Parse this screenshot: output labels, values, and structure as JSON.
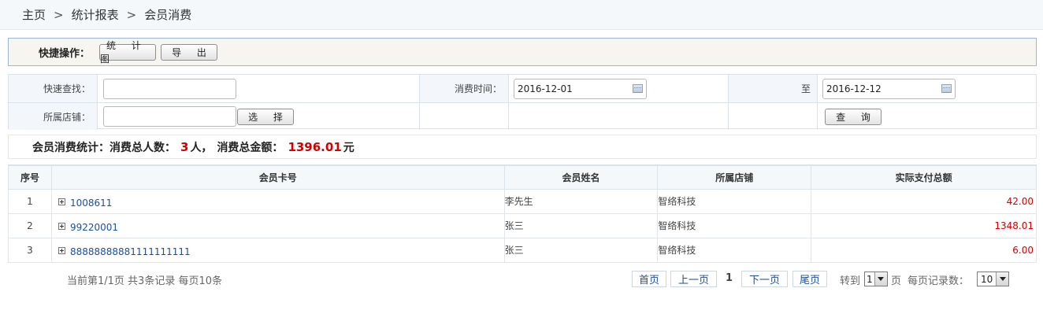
{
  "breadcrumb": [
    "主页",
    "统计报表",
    "会员消费"
  ],
  "breadcrumb_separator": ">",
  "quick_ops": {
    "label": "快捷操作：",
    "chart_button": "统 计 图",
    "export_button": "导 出"
  },
  "search": {
    "quick_find_label": "快速查找：",
    "quick_find_value": "",
    "store_label": "所属店铺：",
    "store_value": "",
    "select_button": "选 择",
    "time_label": "消费时间：",
    "date_from": "2016-12-01",
    "to_label": "至",
    "date_to": "2016-12-12",
    "query_button": "查 询"
  },
  "stats": {
    "prefix": "会员消费统计：消费总人数：",
    "count": "3",
    "count_unit": "人，",
    "amount_label": "消费总金额：",
    "amount": "1396.01",
    "amount_unit": "元"
  },
  "table": {
    "headers": [
      "序号",
      "会员卡号",
      "会员姓名",
      "所属店铺",
      "实际支付总额"
    ],
    "rows": [
      {
        "no": "1",
        "card": "1008611",
        "name": "李先生",
        "store": "智络科技",
        "total": "42.00"
      },
      {
        "no": "2",
        "card": "99220001",
        "name": "张三",
        "store": "智络科技",
        "total": "1348.01"
      },
      {
        "no": "3",
        "card": "88888888881111111111",
        "name": "张三",
        "store": "智络科技",
        "total": "6.00"
      }
    ]
  },
  "pager": {
    "info": "当前第1/1页 共3条记录 每页10条",
    "first": "首页",
    "prev": "上一页",
    "current": "1",
    "next": "下一页",
    "last": "尾页",
    "goto_label": "转到",
    "goto_value": "1",
    "page_unit": "页",
    "per_page_label": "每页记录数：",
    "per_page_value": "10"
  },
  "colors": {
    "amount_red": "#d40000",
    "link_blue": "#1b4f9c",
    "header_bg": "#f4f8fb"
  },
  "icons": {
    "date_picker": "calendar-icon",
    "expand": "plus-box-icon",
    "dropdown": "dropdown-arrow-icon"
  }
}
